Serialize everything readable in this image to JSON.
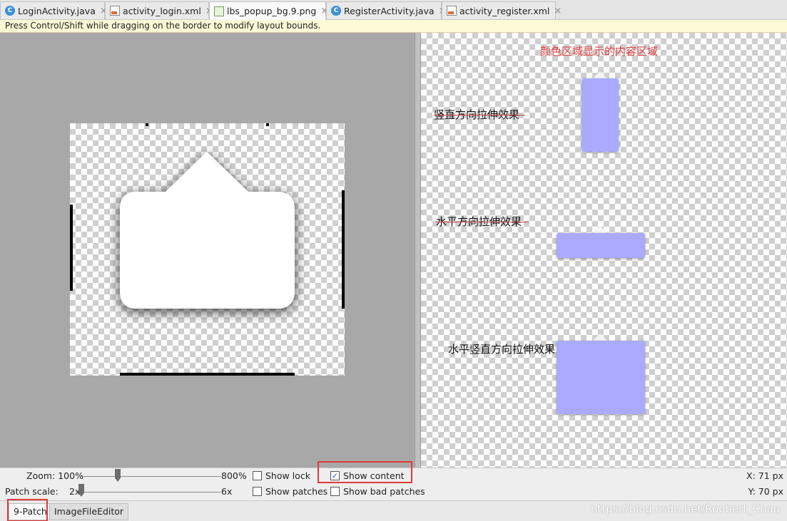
{
  "tabs": [
    {
      "label": "LoginActivity.java",
      "icon": "java-class-icon",
      "active": false
    },
    {
      "label": "activity_login.xml",
      "icon": "xml-layout-icon",
      "active": false
    },
    {
      "label": "lbs_popup_bg.9.png",
      "icon": "png-image-icon",
      "active": true
    },
    {
      "label": "RegisterActivity.java",
      "icon": "java-class-icon",
      "active": false
    },
    {
      "label": "activity_register.xml",
      "icon": "xml-layout-icon",
      "active": false
    }
  ],
  "java_icon_letter": "C",
  "close_glyph": "×",
  "hint": "Press Control/Shift while dragging on the border to modify layout bounds.",
  "preview": {
    "content_label": "颜色区域显示的内容区域",
    "vertical_label": "竖直方向拉伸效果",
    "horizontal_label": "水平方向拉伸效果",
    "both_label": "水平竖直方向拉伸效果",
    "content_color": "#aaaaff"
  },
  "controls": {
    "zoom_label": "Zoom: 100%",
    "zoom_max": "800%",
    "zoom_value_percent": 100,
    "patch_scale_label": "Patch scale:",
    "patch_scale_min": "2x",
    "patch_scale_max": "6x",
    "patch_scale_value": 2,
    "show_lock": {
      "label": "Show lock",
      "checked": false
    },
    "show_content": {
      "label": "Show content",
      "checked": true
    },
    "show_patches": {
      "label": "Show patches",
      "checked": false
    },
    "show_bad_patches": {
      "label": "Show bad patches",
      "checked": false
    },
    "x_readout": "X: 71 px",
    "y_readout": "Y: 70 px",
    "check_glyph": "✓"
  },
  "bottom_tabs": [
    {
      "label": "9-Patch",
      "active": true
    },
    {
      "label": "ImageFileEditor",
      "active": false
    }
  ],
  "watermark": "https://blog.csdn.net/Roobert_Chao",
  "colors": {
    "highlight_frame": "#e03a3a",
    "tab_active": "#fafafa"
  }
}
